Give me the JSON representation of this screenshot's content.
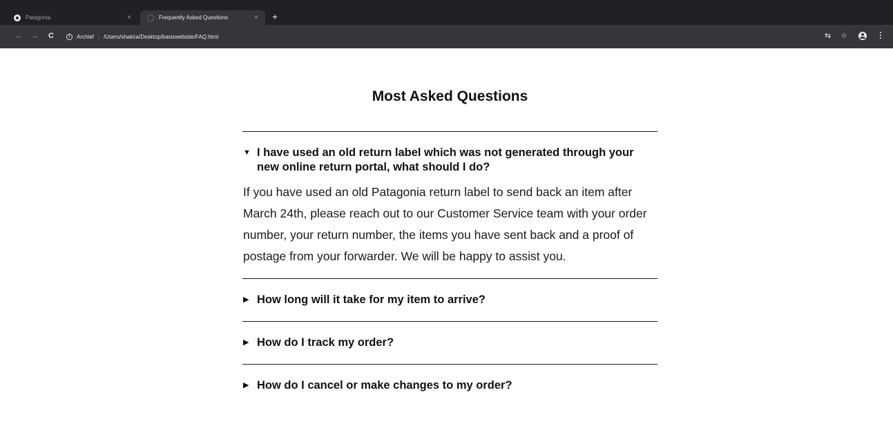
{
  "browser": {
    "tabs": [
      {
        "title": "Patagonia",
        "active": false
      },
      {
        "title": "Frequently Asked Questions",
        "active": true
      }
    ],
    "tab_close": "×",
    "new_tab": "+",
    "nav": {
      "back": "←",
      "forward": "→",
      "reload": "C"
    },
    "omnibox": {
      "info": "i",
      "site_chip": "Archief",
      "separator": "|",
      "url": "/Users/shakira/Desktop/basiswebsite/FAQ.html"
    },
    "toolbar_icons": {
      "translate": "⇆",
      "bookmark": "☆"
    }
  },
  "page": {
    "title": "Most Asked Questions",
    "faq": [
      {
        "open": true,
        "caret": "▼",
        "question": "I have used an old return label which was not generated through your new online return portal, what should I do?",
        "answer": "If you have used an old Patagonia return label to send back an item after March 24th, please reach out to our Customer Service team with your order number, your return number, the items you have sent back and a proof of postage from your forwarder. We will be happy to assist you."
      },
      {
        "open": false,
        "caret": "▶",
        "question": "How long will it take for my item to arrive?"
      },
      {
        "open": false,
        "caret": "▶",
        "question": "How do I track my order?"
      },
      {
        "open": false,
        "caret": "▶",
        "question": "How do I cancel or make changes to my order?"
      }
    ]
  },
  "colors": {
    "chrome_dark": "#202124",
    "toolbar": "#35363a",
    "text": "#111111"
  }
}
